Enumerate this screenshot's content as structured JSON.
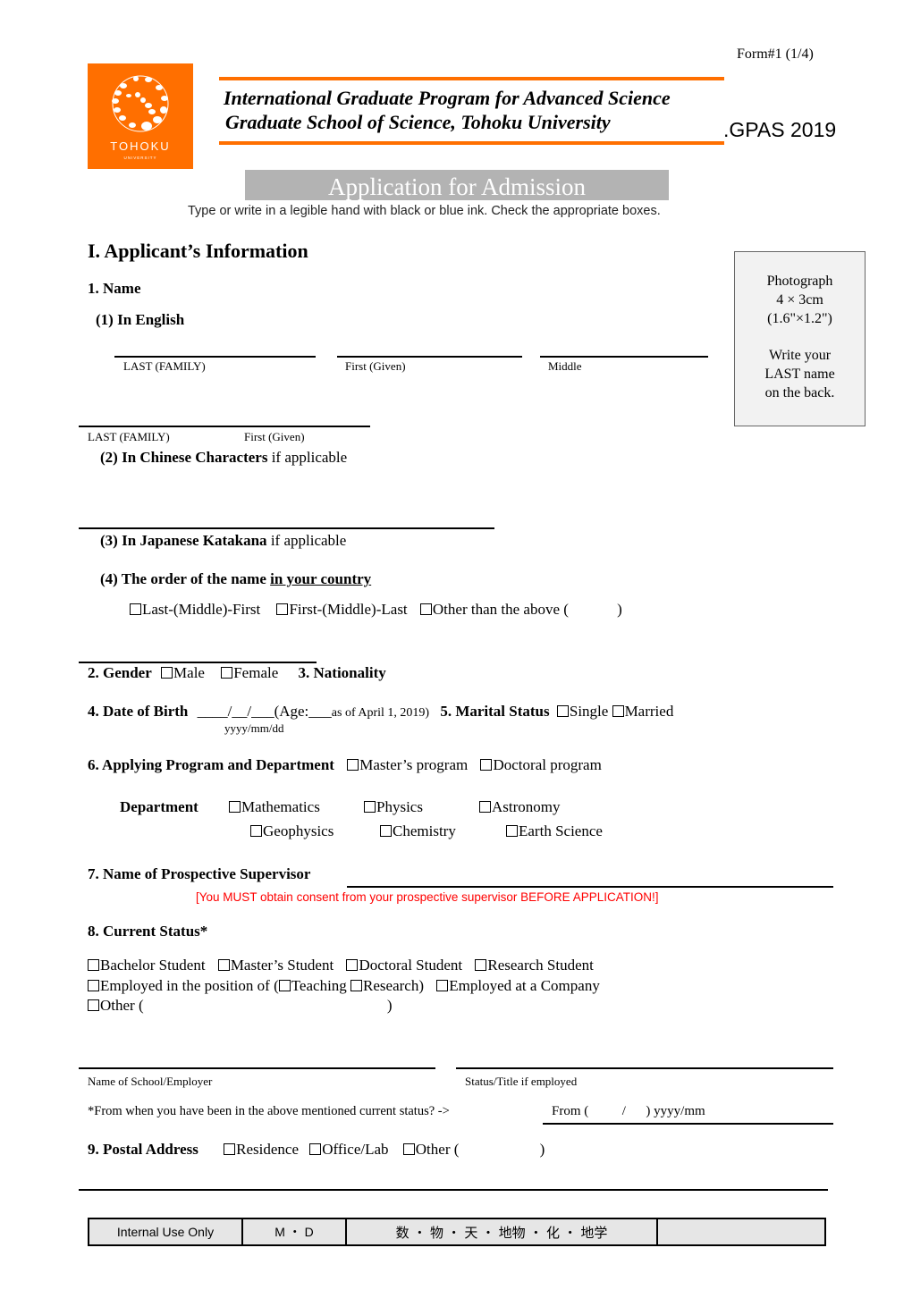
{
  "form_number": "Form#1 (1/4)",
  "logo": {
    "name": "TOHOKU",
    "sub": "UNIVERSITY"
  },
  "header": {
    "line1": "International Graduate Program for Advanced Science",
    "line2": "Graduate School of Science, Tohoku  University",
    "program": ".GPAS 2019",
    "accent_color": "#ff6f00"
  },
  "title": "Application for Admission",
  "instructions": "Type or write in a legible hand with black or blue ink. Check the appropriate boxes.",
  "section_title": "I. Applicant’s Information",
  "photo_box": {
    "lines": [
      "Photograph",
      "4 × 3cm",
      "(1.6\"×1.2\")",
      "",
      "Write your",
      "LAST name",
      "on the back."
    ]
  },
  "name": {
    "heading": "1. Name",
    "english": {
      "label": "(1)  In English",
      "fields": [
        "LAST (FAMILY)",
        "First (Given)",
        "Middle"
      ]
    },
    "chinese_fields": [
      "LAST (FAMILY)",
      "First (Given)"
    ],
    "chinese": {
      "label_bold": "(2) In Chinese Characters",
      "label_rest": " if applicable"
    },
    "katakana": {
      "label_bold": "(3) In Japanese Katakana",
      "label_rest": " if applicable"
    },
    "order": {
      "label_bold": "(4) The order of the name ",
      "label_underline": "in your country",
      "options": [
        "Last-(Middle)-First",
        "First-(Middle)-Last",
        "Other than the above ("
      ],
      "close": ")"
    }
  },
  "gender": {
    "label": "2. Gender",
    "options": [
      "Male",
      "Female"
    ]
  },
  "nationality": {
    "label": "3. Nationality"
  },
  "dob": {
    "label": "4. Date of Birth",
    "blank": "____/__/___",
    "age_prefix": "(Age:",
    "age_blank": "___",
    "age_suffix": "as of April 1, 2019)",
    "format": "yyyy/mm/dd"
  },
  "marital": {
    "label": "5. Marital Status",
    "options": [
      "Single",
      "Married"
    ]
  },
  "program": {
    "label": "6. Applying Program and Department",
    "options": [
      "Master’s program",
      "Doctoral program"
    ]
  },
  "department": {
    "label": "Department",
    "row1": [
      "Mathematics",
      "Physics",
      "Astronomy"
    ],
    "row2": [
      "Geophysics",
      "Chemistry",
      "Earth Science"
    ]
  },
  "supervisor": {
    "label": "7. Name of Prospective Supervisor",
    "warning": "[You MUST obtain consent from your prospective supervisor BEFORE APPLICATION!]",
    "warning_color": "#ff0000"
  },
  "status": {
    "label": "8. Current Status*",
    "row1": [
      "Bachelor Student",
      "Master’s Student",
      "Doctoral Student",
      "Research Student"
    ],
    "row2_prefix": "Employed in the position of (",
    "row2_sub": [
      "Teaching",
      "Research)"
    ],
    "row2_company": "Employed at a Company",
    "row3": "Other (",
    "row3_close": ")",
    "school_label": "Name of School/Employer",
    "title_label": "Status/Title if employed",
    "since_question": "*From when you have been in the above mentioned current status?  ->",
    "since_value": "From (          /      ) yyyy/mm"
  },
  "postal": {
    "label": "9. Postal Address",
    "options": [
      "Residence",
      "Office/Lab",
      "Other ("
    ],
    "close": ")"
  },
  "internal_use": {
    "cells": [
      "Internal Use Only",
      "M ・ D",
      "数 ・ 物 ・ 天 ・ 地物 ・ 化 ・ 地学",
      ""
    ]
  }
}
